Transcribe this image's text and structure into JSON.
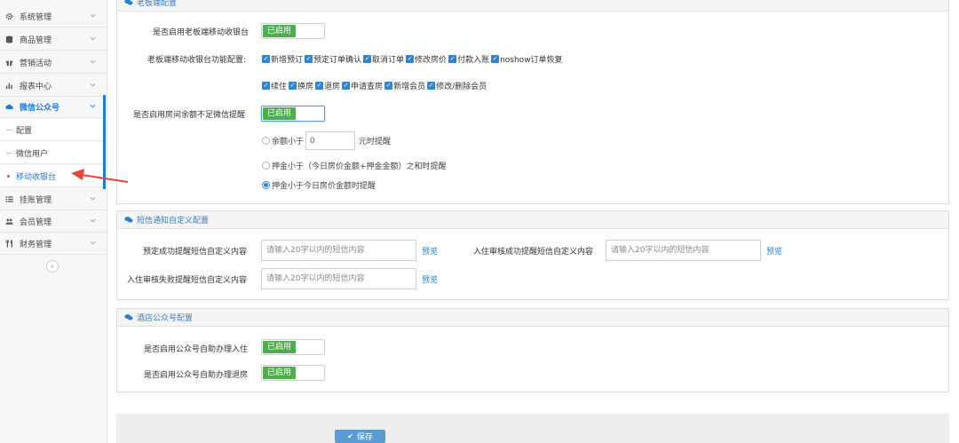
{
  "sidebar": {
    "items": [
      {
        "label": "系统管理",
        "icon": "gear-icon"
      },
      {
        "label": "商品管理",
        "icon": "database-icon"
      },
      {
        "label": "营销活动",
        "icon": "gift-icon"
      },
      {
        "label": "报表中心",
        "icon": "bar-chart-icon"
      },
      {
        "label": "微信公众号",
        "icon": "cloud-icon"
      },
      {
        "label": "挂账管理",
        "icon": "list-icon"
      },
      {
        "label": "会员管理",
        "icon": "users-icon"
      },
      {
        "label": "财务管理",
        "icon": "cutlery-icon"
      }
    ],
    "sub_items": [
      {
        "label": "配置"
      },
      {
        "label": "微信用户"
      },
      {
        "label": "移动收银台"
      }
    ],
    "collapse_icon": "«"
  },
  "boss_panel": {
    "title": "老板端配置",
    "enable_label": "是否启用老板端移动收银台",
    "enable_state": "已启用",
    "features_label": "老板端移动收银台功能配置:",
    "features_row1": [
      "新增预订",
      "预定订单确认",
      "取消订单",
      "修改房价",
      "付款入账",
      "noshow订单恢复"
    ],
    "features_row2": [
      "续住",
      "换房",
      "退房",
      "申请查房",
      "新增会员",
      "修改/删除会员"
    ],
    "balance_label": "是否启用房间余额不足微信提醒",
    "balance_state": "已启用",
    "radio1_prefix": "余额小于",
    "radio1_value": "0",
    "radio1_suffix": "元时提醒",
    "radio2_text": "押金小于（今日房价金额+押金金额）之和时提醒",
    "radio3_text": "押金小于今日房价金额时提醒",
    "selected_radio": 3
  },
  "sms_panel": {
    "title": "短信通知自定义配置",
    "booking_label": "预定成功提醒短信自定义内容",
    "checkin_ok_label": "入住审核成功提醒短信自定义内容",
    "checkin_fail_label": "入住审核失败提醒短信自定义内容",
    "placeholder": "请输入20字以内的短信内容",
    "preview": "预览"
  },
  "hotel_panel": {
    "title": "酒店公众号配置",
    "checkin_label": "是否启用公众号自助办理入住",
    "checkin_state": "已启用",
    "checkout_label": "是否启用公众号自助办理退房",
    "checkout_state": "已启用"
  },
  "footer": {
    "save_label": "保存",
    "save_icon": "✔"
  },
  "colors": {
    "accent": "#2b86de",
    "enabled": "#4cae4c",
    "annotation_arrow": "#e8443a"
  }
}
